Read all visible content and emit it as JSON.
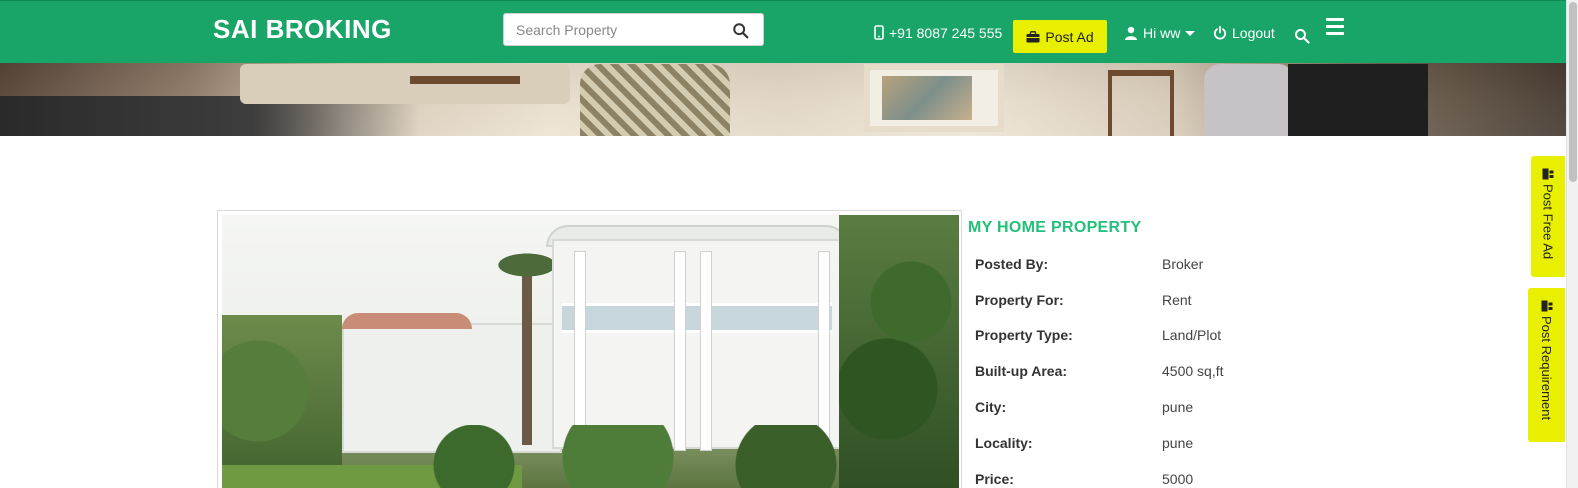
{
  "brand": {
    "name": "SAI BROKING"
  },
  "search": {
    "placeholder": "Search Property",
    "icon": "search-icon"
  },
  "header": {
    "phone": "+91 8087 245 555",
    "post_ad_label": "Post Ad",
    "user_label": "Hi ww",
    "logout_label": "Logout",
    "menu_icon": "hamburger-menu-icon"
  },
  "property": {
    "title": "MY HOME PROPERTY",
    "details": [
      {
        "label": "Posted By:",
        "value": "Broker"
      },
      {
        "label": "Property For:",
        "value": "Rent"
      },
      {
        "label": "Property Type:",
        "value": "Land/Plot"
      },
      {
        "label": "Built-up Area:",
        "value": "4500 sq,ft"
      },
      {
        "label": "City:",
        "value": "pune"
      },
      {
        "label": "Locality:",
        "value": "pune"
      },
      {
        "label": "Price:",
        "value": "5000"
      }
    ]
  },
  "side_tabs": {
    "free_ad": "Post Free Ad",
    "requirement": "Post Requirement"
  },
  "colors": {
    "navbar": "#1aa568",
    "accent_yellow": "#e8f000",
    "title_green": "#22c07a"
  }
}
